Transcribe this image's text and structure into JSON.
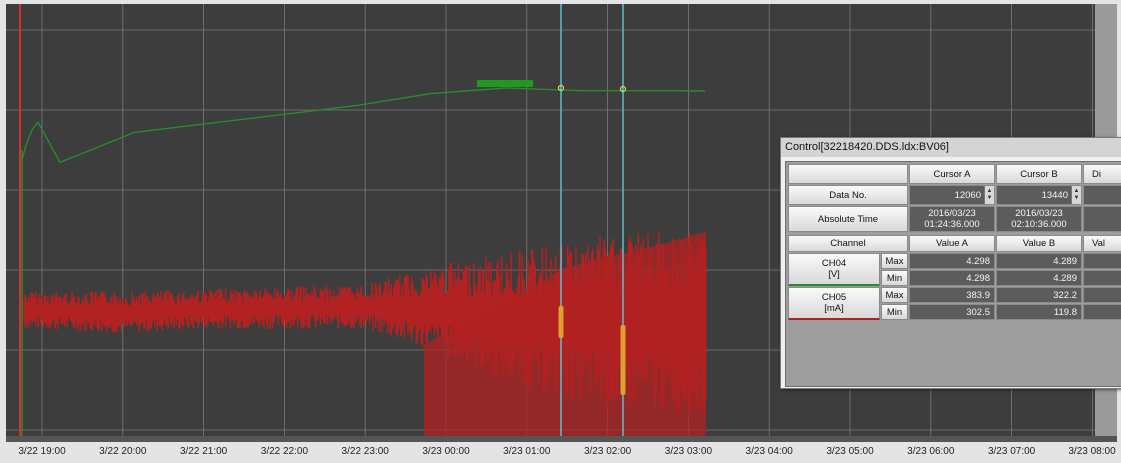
{
  "window": {
    "title": "Control[32218420.DDS.ldx:BV06]"
  },
  "chart": {
    "background": "#3d3d3d",
    "grid_color": "#7a7a7a",
    "x_tick_labels": [
      "3/22 19:00",
      "3/22 20:00",
      "3/22 21:00",
      "3/22 22:00",
      "3/22 23:00",
      "3/23 00:00",
      "3/23 01:00",
      "3/23 02:00",
      "3/23 03:00",
      "3/23 04:00",
      "3/23 05:00",
      "3/23 06:00",
      "3/23 07:00",
      "3/23 08:00"
    ],
    "cursor_color": "#5fc8d6",
    "cursor_a_time": "2016/03/23 01:24:36.000",
    "cursor_b_time": "2016/03/23 02:10:36.000"
  },
  "chart_data": {
    "type": "line",
    "x": [
      "3/22 19:00",
      "3/22 20:00",
      "3/22 21:00",
      "3/22 22:00",
      "3/22 23:00",
      "3/23 00:00",
      "3/23 01:00",
      "3/23 02:00",
      "3/23 03:00"
    ],
    "series": [
      {
        "name": "CH04",
        "unit": "V",
        "color": "#2b8a2b",
        "values": [
          4.05,
          4.15,
          4.18,
          4.21,
          4.24,
          4.28,
          4.298,
          4.289,
          4.289
        ]
      },
      {
        "name": "CH05",
        "unit": "mA",
        "color": "#b22222",
        "style": "noisy envelope",
        "envelope_min": [
          300,
          290,
          300,
          300,
          300,
          240,
          170,
          130,
          120
        ],
        "envelope_max": [
          380,
          380,
          385,
          390,
          395,
          440,
          470,
          500,
          510
        ]
      }
    ],
    "grid": true,
    "x_range": [
      "3/22 19:00",
      "3/23 08:00"
    ]
  },
  "panel": {
    "col_cursor_a": "Cursor A",
    "col_cursor_b": "Cursor B",
    "col_diff": "Di",
    "row_data_no": "Data No.",
    "row_abs_time": "Absolute Time",
    "data_no_a": "12060",
    "data_no_b": "13440",
    "abs_time_a_date": "2016/03/23",
    "abs_time_a_time": "01:24:36.000",
    "abs_time_b_date": "2016/03/23",
    "abs_time_b_time": "02:10:36.000",
    "col_channel": "Channel",
    "col_value_a": "Value A",
    "col_value_b": "Value B",
    "col_val": "Val",
    "channels": [
      {
        "name": "CH04",
        "unit": "[V]",
        "color": "#2b8a2b",
        "rows": [
          {
            "kind": "Max",
            "a": "4.298",
            "b": "4.289"
          },
          {
            "kind": "Min",
            "a": "4.298",
            "b": "4.289"
          }
        ]
      },
      {
        "name": "CH05",
        "unit": "[mA]",
        "color": "#b22222",
        "rows": [
          {
            "kind": "Max",
            "a": "383.9",
            "b": "322.2"
          },
          {
            "kind": "Min",
            "a": "302.5",
            "b": "119.8"
          }
        ]
      }
    ]
  }
}
